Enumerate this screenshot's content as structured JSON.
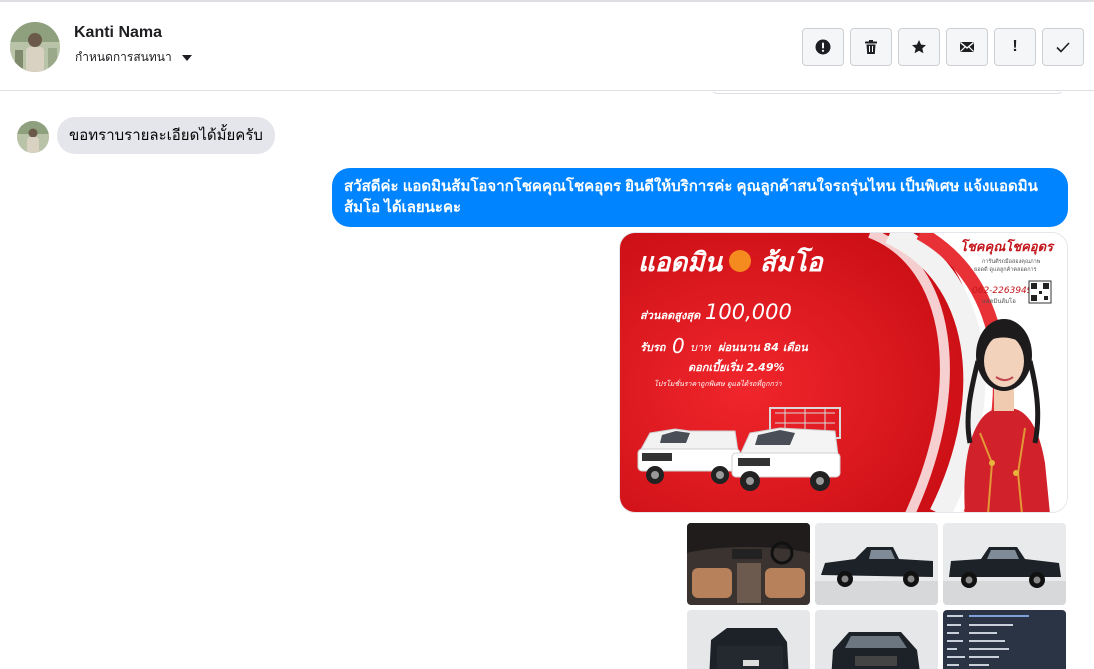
{
  "header": {
    "contact_name": "Kanti Nama",
    "assign_label": "กำหนดการสนทนา"
  },
  "actions": [
    {
      "name": "spam-button",
      "icon": "alert-circle-icon"
    },
    {
      "name": "delete-button",
      "icon": "trash-icon"
    },
    {
      "name": "star-button",
      "icon": "star-icon"
    },
    {
      "name": "mark-unread-button",
      "icon": "envelope-icon"
    },
    {
      "name": "follow-up-button",
      "icon": "exclamation-icon",
      "text": "!"
    },
    {
      "name": "mark-done-button",
      "icon": "check-icon"
    }
  ],
  "messages": {
    "incoming_text": "ขอทราบรายละเอียดได้มั้ยครับ",
    "outgoing_text": "สวัสดีค่ะ แอดมินส้มโอจากโชคคุณโชคอุดร ยินดีให้บริการค่ะ   คุณลูกค้าสนใจรถรุ่นไหน เป็นพิเศษ แจ้งแอดมินส้มโอ ได้เลยนะคะ"
  },
  "promo": {
    "admin_title": "แอดมิน",
    "admin_name": "ส้มโอ",
    "brand": "โชคคุณโชคอุดร",
    "brand_sub1": "การันตีรถมือสองคุณภาพ",
    "brand_sub2": "ยอดดี ดูแลลูกค้าตลอดการ",
    "phone": "062-2263949",
    "admin_line": "แอดมินส้มโอ",
    "discount": "ส่วนลดสูงสุด",
    "discount_value": "100,000",
    "down_label": "รับรถ",
    "down_value": "0",
    "down_unit": "บาท",
    "installment": "ผ่อนนาน 84 เดือน",
    "interest": "ดอกเบี้ยเริ่ม 2.49%",
    "fineprint": "โปรโมชั่นราคาถูกพิเศษ ดูแลได้รถที่ถูกกว่า"
  },
  "colors": {
    "accent_blue": "#0084ff",
    "incoming_bubble": "#e4e6eb",
    "promo_red": "#e3151b"
  }
}
